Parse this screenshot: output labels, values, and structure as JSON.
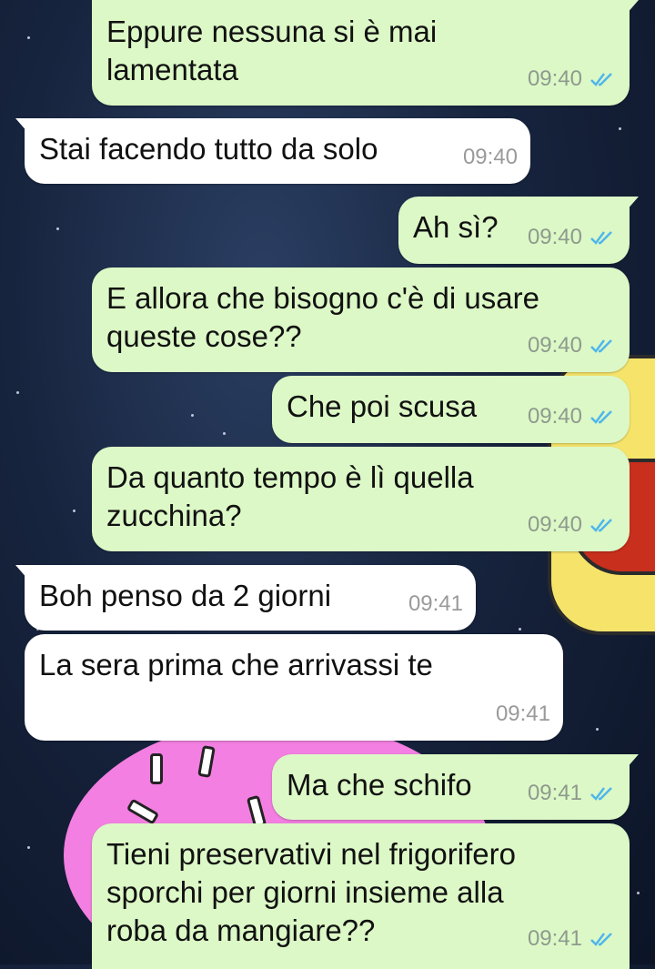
{
  "theme": {
    "outgoing_bubble": "#dcf8c6",
    "incoming_bubble": "#ffffff",
    "read_ticks": "#4fb6ec"
  },
  "messages": [
    {
      "direction": "outgoing",
      "lines": [
        "Eppure nessuna si è mai",
        "lamentata"
      ],
      "time": "09:40",
      "status": "read"
    },
    {
      "direction": "incoming",
      "lines": [
        "Stai facendo tutto da solo"
      ],
      "time": "09:40"
    },
    {
      "direction": "outgoing",
      "lines": [
        "Ah sì?"
      ],
      "time": "09:40",
      "status": "read"
    },
    {
      "direction": "outgoing",
      "lines": [
        "E allora che bisogno c'è di usare",
        "queste cose??"
      ],
      "time": "09:40",
      "status": "read"
    },
    {
      "direction": "outgoing",
      "lines": [
        "Che poi scusa"
      ],
      "time": "09:40",
      "status": "read"
    },
    {
      "direction": "outgoing",
      "lines": [
        "Da quanto tempo è lì quella",
        "zucchina?"
      ],
      "time": "09:40",
      "status": "read"
    },
    {
      "direction": "incoming",
      "lines": [
        "Boh penso da 2 giorni"
      ],
      "time": "09:41"
    },
    {
      "direction": "incoming",
      "lines": [
        "La sera prima che arrivassi te"
      ],
      "time": "09:41"
    },
    {
      "direction": "outgoing",
      "lines": [
        "Ma che schifo"
      ],
      "time": "09:41",
      "status": "read"
    },
    {
      "direction": "outgoing",
      "lines": [
        "Tieni preservativi nel frigorifero",
        "sporchi per giorni insieme alla",
        "roba da mangiare??"
      ],
      "time": "09:41",
      "status": "read"
    }
  ]
}
